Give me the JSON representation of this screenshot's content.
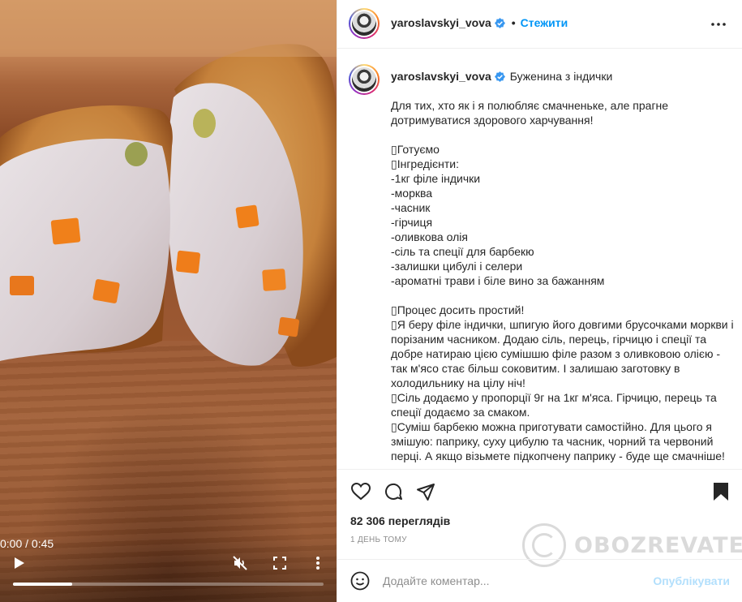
{
  "video": {
    "time": "0:00 / 0:45",
    "progress": 0.19
  },
  "post": {
    "username": "yaroslavskyi_vova",
    "follow_label": "Стежити",
    "separator": "•",
    "title": "Буженина з індички",
    "caption": "Для тих, хто як і я полюбляє смачненьке, але прагне дотримуватися здорового харчування!\n\n▯Готуємо\n▯Інгредієнти:\n-1кг філе індички\n-морква\n-часник\n-гірчиця\n-оливкова олія\n-сіль та спеції для барбекю\n-залишки цибулі і селери\n-ароматні трави і біле вино за бажанням\n\n▯Процес досить простий!\n▯Я беру філе індички, шпигую його довгими брусочками моркви і порізаним часником. Додаю сіль, перець, гірчицю і спеції та добре натираю цією сумішшю філе разом з оливковою олією - так м'ясо стає більш соковитим. І залишаю заготовку в холодильнику на цілу ніч!\n▯Сіль додаємо у пропорції 9г на 1кг м'яса. Гірчицю, перець та спеції додаємо за смаком.\n▯Суміш барбекю можна приготувати самостійно. Для цього я змішую: паприку, суху цибулю та часник, чорний та червоний перці. А якщо візьмете підкопчену паприку - буде ще смачніше!",
    "views": "82 306 переглядів",
    "time_ago": "1 день тому"
  },
  "comment": {
    "placeholder": "Додайте коментар...",
    "publish_label": "Опублікувати"
  },
  "watermark": {
    "text": "OBOZREVATEL"
  },
  "icons": {
    "verified": "verified-badge-icon",
    "more": "more-horizontal-icon",
    "like": "heart-icon",
    "comment": "comment-bubble-icon",
    "share": "paper-plane-icon",
    "save": "bookmark-icon",
    "emoji": "smiley-icon",
    "play": "play-icon",
    "mute": "speaker-muted-icon",
    "fullscreen": "fullscreen-icon",
    "video_more": "more-vertical-icon"
  },
  "colors": {
    "accent": "#0095f6",
    "publish_disabled": "#b2dffc",
    "muted_text": "#8e8e8e"
  }
}
